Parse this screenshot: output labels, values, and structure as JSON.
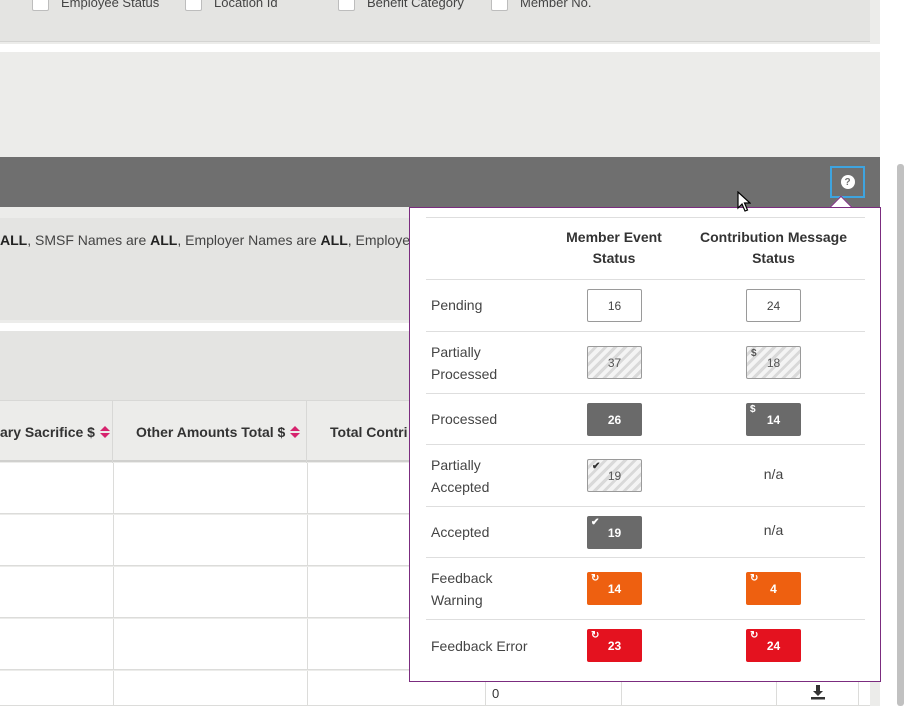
{
  "filters": [
    "Employee Status",
    "Location Id",
    "Benefit Category",
    "Member No."
  ],
  "summary": {
    "p1": "ALL",
    "p2": ", SMSF Names are ",
    "p3": "ALL",
    "p4": ", Employer Names are ",
    "p5": "ALL",
    "p6": ", Employee S"
  },
  "table": {
    "headers": [
      "ary Sacrifice $",
      "Other Amounts Total $",
      "Total Contri"
    ],
    "last_row_value": "0"
  },
  "popover": {
    "col_headers": [
      "Member Event Status",
      "Contribution Message Status"
    ],
    "rows": [
      {
        "label": "Pending",
        "member": "16",
        "contribution": "24"
      },
      {
        "label": "Partially Processed",
        "member": "37",
        "contribution": "18"
      },
      {
        "label": "Processed",
        "member": "26",
        "contribution": "14"
      },
      {
        "label": "Partially Accepted",
        "member": "19",
        "contribution": "n/a"
      },
      {
        "label": "Accepted",
        "member": "19",
        "contribution": "n/a"
      },
      {
        "label": "Feedback Warning",
        "member": "14",
        "contribution": "4"
      },
      {
        "label": "Feedback Error",
        "member": "23",
        "contribution": "24"
      }
    ],
    "marks": {
      "dollar": "$",
      "check": "✔",
      "refresh": "↻"
    }
  },
  "colors": {
    "accent_focus": "#3ea4e0",
    "sort_arrow": "#d6246e",
    "popover_border": "#7b2c7f",
    "warning": "#ee6010",
    "error": "#e4121f",
    "processed": "#6a6a6a"
  },
  "icons": {
    "help": "question-circle-icon",
    "download": "download-icon"
  }
}
